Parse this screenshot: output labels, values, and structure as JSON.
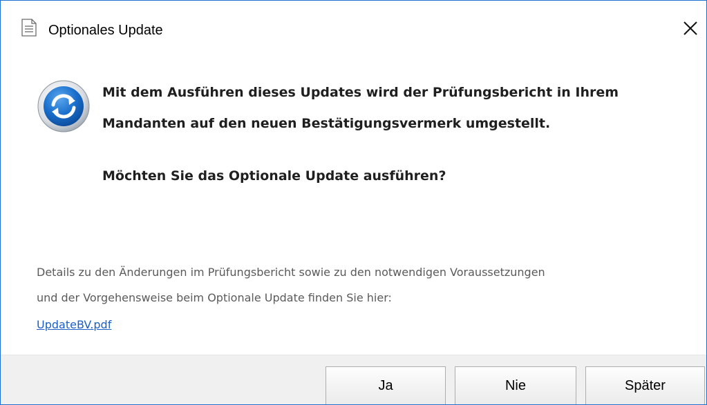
{
  "window": {
    "title": "Optionales Update",
    "title_icon": "document-icon",
    "close_icon": "close-icon"
  },
  "message": {
    "icon": "update-refresh-icon",
    "line1": "Mit dem Ausführen dieses Updates wird der Prüfungsbericht in Ihrem",
    "line2": "Mandanten auf den neuen Bestätigungsvermerk umgestellt.",
    "question": "Möchten Sie das Optionale Update ausführen?"
  },
  "details": {
    "line1": "Details zu den Änderungen im Prüfungsbericht sowie zu den notwendigen Voraussetzungen",
    "line2": "und der Vorgehensweise beim Optionale Update finden Sie hier:",
    "link_text": "UpdateBV.pdf"
  },
  "buttons": {
    "yes": "Ja",
    "never": "Nie",
    "later": "Später"
  },
  "colors": {
    "window_border": "#1e6fd0",
    "link": "#1a5fc7",
    "footer_bg": "#f0f0f0",
    "icon_blue": "#1565c0"
  }
}
